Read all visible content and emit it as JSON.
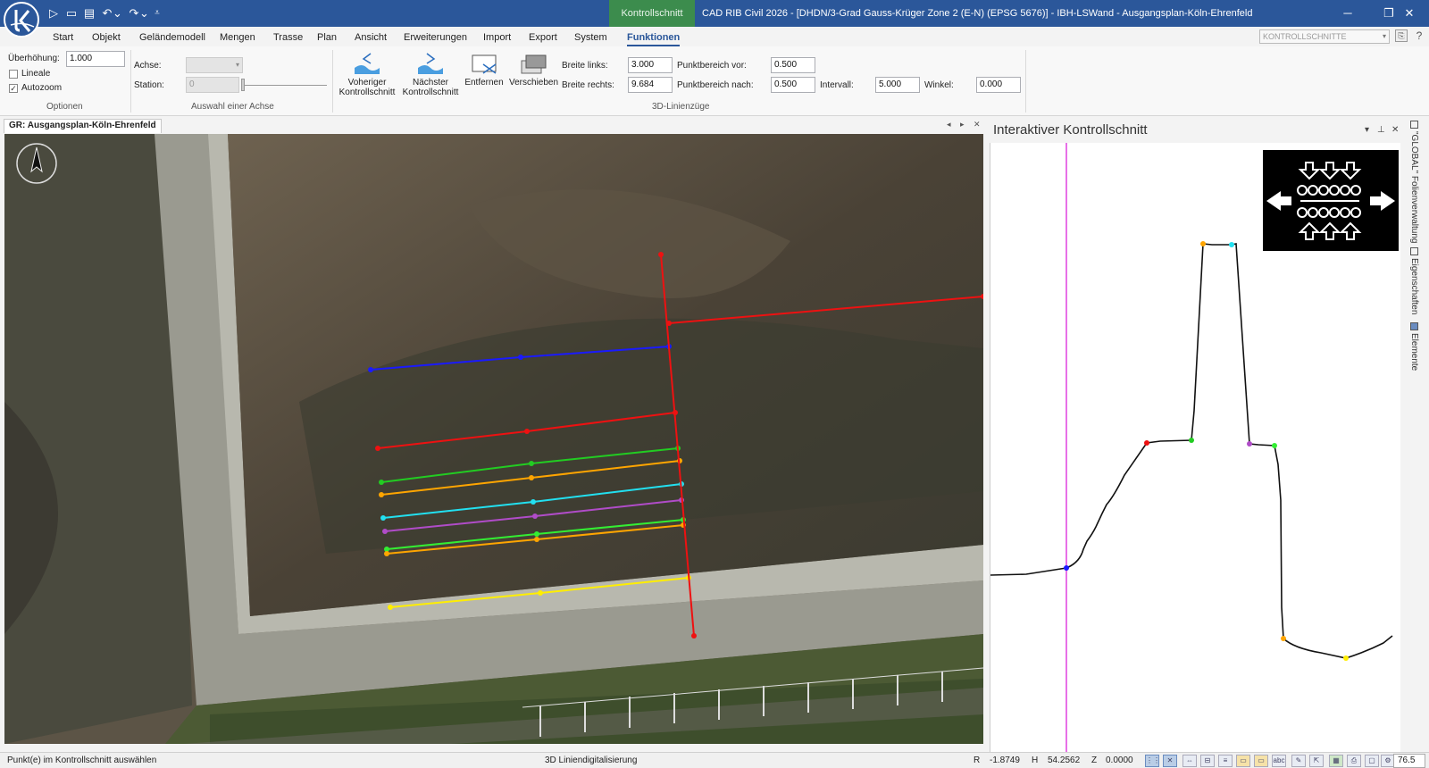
{
  "titlebar": {
    "context_tab": "Kontrollschnitt",
    "title": "CAD RIB Civil 2026 - [DHDN/3-Grad Gauss-Krüger Zone 2 (E-N) (EPSG 5676)] - IBH-LSWand - Ausgangsplan-Köln-Ehrenfeld",
    "minimize": "─",
    "restore": "❐",
    "close": "✕"
  },
  "quick_access": {
    "play": "▷",
    "save": "▭",
    "open": "▤",
    "undo": "↶",
    "undo_arrow": "⌄",
    "redo": "↷",
    "redo_arrow": "⌄",
    "customize": "⩡"
  },
  "menu": {
    "tabs": [
      "Start",
      "Objekt",
      "Geländemodell",
      "Mengen",
      "Trasse",
      "Plan",
      "Ansicht",
      "Erweiterungen",
      "Import",
      "Export",
      "System",
      "Funktionen"
    ],
    "active_index": 11,
    "combo_value": "KONTROLLSCHNITTE"
  },
  "ribbon": {
    "optionen": {
      "label": "Optionen",
      "ueberhoehung_label": "Überhöhung:",
      "ueberhoehung_value": "1.000",
      "lineale_label": "Lineale",
      "lineale_checked": false,
      "autozoom_label": "Autozoom",
      "autozoom_checked": true
    },
    "achse": {
      "label": "Auswahl einer Achse",
      "achse_label": "Achse:",
      "station_label": "Station:",
      "station_value": "0"
    },
    "linienzuege": {
      "label": "3D-Linienzüge",
      "prev_line1": "Voheriger",
      "prev_line2": "Kontrollschnitt",
      "next_line1": "Nächster",
      "next_line2": "Kontrollschnitt",
      "remove": "Entfernen",
      "move": "Verschieben",
      "breite_links_label": "Breite links:",
      "breite_links_value": "3.000",
      "breite_rechts_label": "Breite rechts:",
      "breite_rechts_value": "9.684",
      "pb_vor_label": "Punktbereich vor:",
      "pb_vor_value": "0.500",
      "pb_nach_label": "Punktbereich nach:",
      "pb_nach_value": "0.500",
      "intervall_label": "Intervall:",
      "intervall_value": "5.000",
      "winkel_label": "Winkel:",
      "winkel_value": "0.000"
    }
  },
  "document": {
    "tab_label": "GR: Ausgangsplan-Köln-Ehrenfeld",
    "controls": [
      "◂",
      "▸",
      "✕"
    ]
  },
  "map": {
    "line_colors": {
      "blue": "#1a1aff",
      "red": "#ee1111",
      "green": "#22cc22",
      "orange": "#ffa500",
      "cyan": "#22e0f0",
      "purple": "#b04cc8",
      "lime": "#33ee33",
      "yellow": "#ffee00"
    }
  },
  "right_panel": {
    "title": "Interaktiver Kontrollschnitt",
    "controls": [
      "▾",
      "⊥",
      "✕"
    ]
  },
  "side_tabs": [
    "\"GLOBAL\" Folienverwaltung",
    "Eigenschaften",
    "Elemente"
  ],
  "status": {
    "hint": "Punkt(e) im Kontrollschnitt auswählen",
    "mode": "3D Liniendigitalisierung",
    "r_label": "R",
    "r_value": "-1.8749",
    "h_label": "H",
    "h_value": "54.2562",
    "z_label": "Z",
    "z_value": "0.0000",
    "zoom": "76.5"
  },
  "colors": {
    "accent": "#2b579a",
    "context": "#3c8c4d",
    "marker_line": "#e040e0"
  }
}
